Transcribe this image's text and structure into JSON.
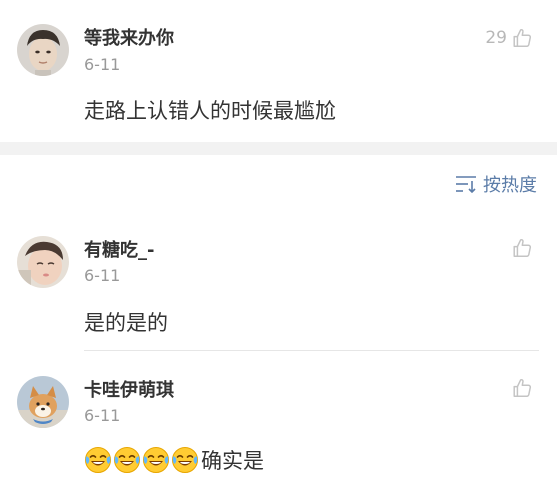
{
  "main_comment": {
    "username": "等我来办你",
    "date": "6-11",
    "text": "走路上认错人的时候最尴尬",
    "like_count": "29",
    "like_icon": "thumbs-up-icon"
  },
  "sort": {
    "label": "按热度",
    "icon": "sort-icon",
    "accent_color": "#5b7ca8"
  },
  "replies": [
    {
      "username": "有糖吃_-",
      "date": "6-11",
      "text": "是的是的",
      "like_icon": "thumbs-up-icon"
    },
    {
      "username": "卡哇伊萌琪",
      "date": "6-11",
      "emoji_icons": [
        "laugh-cry-emoji",
        "laugh-cry-emoji",
        "laugh-cry-emoji",
        "laugh-cry-emoji"
      ],
      "text": "确实是",
      "like_icon": "thumbs-up-icon"
    }
  ]
}
